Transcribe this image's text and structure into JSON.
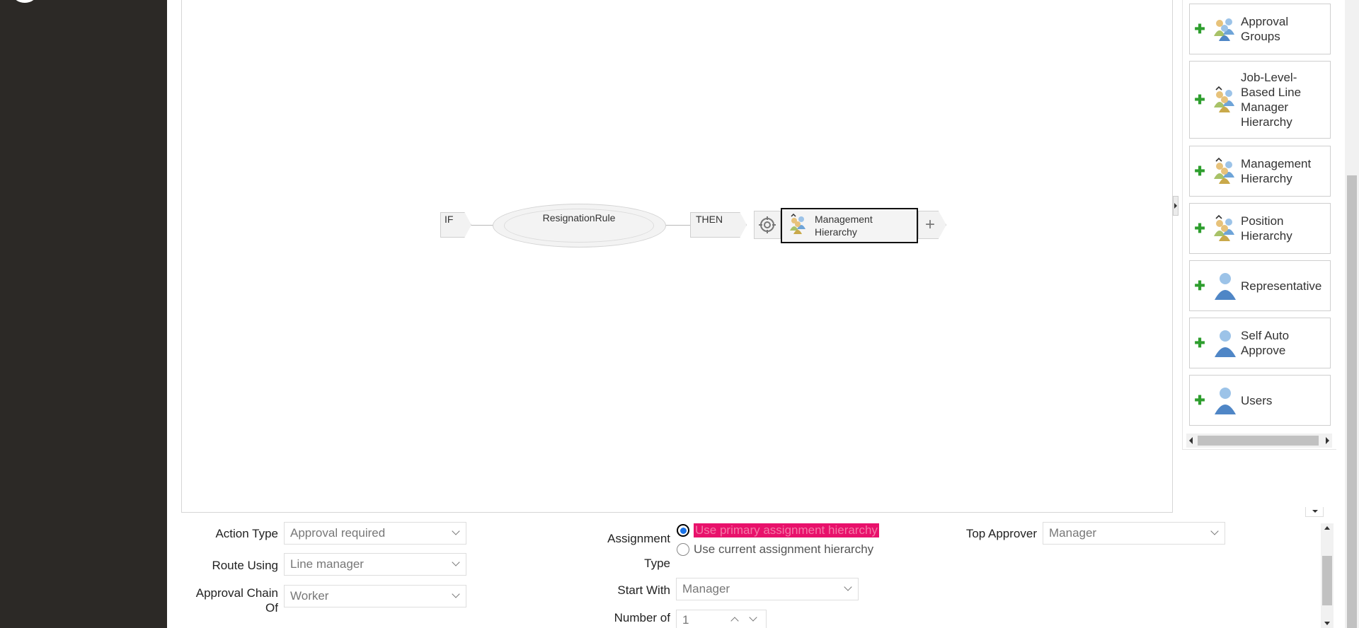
{
  "canvas": {
    "if_label": "IF",
    "rule_name": "ResignationRule",
    "then_label": "THEN",
    "action_node": {
      "line1": "Management",
      "line2": "Hierarchy",
      "icon": "group-hierarchy-icon"
    },
    "add_icon": "plus-icon"
  },
  "palette": {
    "items": [
      {
        "label_lines": [
          "Approval",
          "Groups"
        ],
        "icon": "group-users-icon"
      },
      {
        "label_lines": [
          "Job-Level-",
          "Based Line",
          "Manager",
          "Hierarchy"
        ],
        "icon": "group-hierarchy-icon"
      },
      {
        "label_lines": [
          "Management",
          "Hierarchy"
        ],
        "icon": "group-hierarchy-icon"
      },
      {
        "label_lines": [
          "Position",
          "Hierarchy"
        ],
        "icon": "group-hierarchy-icon"
      },
      {
        "label_lines": [
          "Representative"
        ],
        "icon": "single-user-icon"
      },
      {
        "label_lines": [
          "Self Auto",
          "Approve"
        ],
        "icon": "single-user-icon"
      },
      {
        "label_lines": [
          "Users"
        ],
        "icon": "single-user-icon"
      }
    ]
  },
  "form": {
    "action_type": {
      "label": "Action Type",
      "value": "Approval required"
    },
    "route_using": {
      "label": "Route Using",
      "value": "Line manager"
    },
    "approval_chain": {
      "label_line1": "Approval Chain",
      "label_line2": "Of",
      "value": "Worker"
    },
    "assignment_type": {
      "label_line1": "Assignment",
      "label_line2": "Type",
      "options": [
        "Use primary assignment hierarchy",
        "Use current assignment hierarchy"
      ],
      "selected_index": 0
    },
    "start_with": {
      "label": "Start With",
      "value": "Manager"
    },
    "number_of": {
      "label": "Number of",
      "value": "1"
    },
    "top_approver": {
      "label": "Top Approver",
      "value": "Manager"
    }
  },
  "colors": {
    "left_rail": "#2c2926",
    "highlight": "#e8116b",
    "add_icon_green": "#2e9e2e",
    "radio_selected": "#1a73e8"
  }
}
